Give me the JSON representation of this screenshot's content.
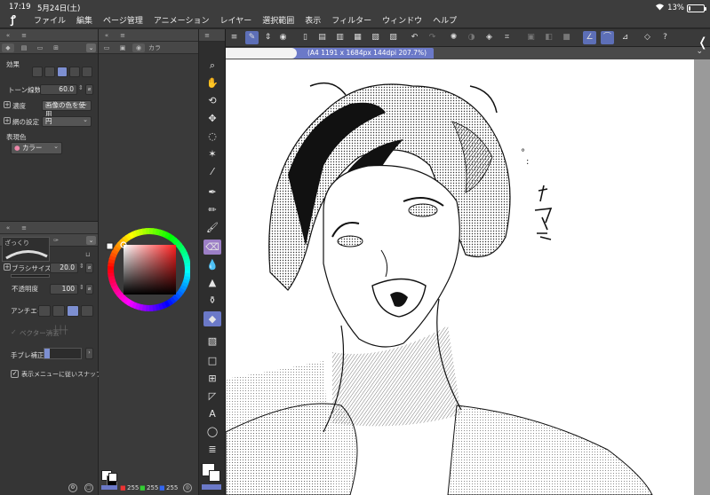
{
  "status": {
    "time": "17:19",
    "date": "5月24日(土)",
    "battery": "13%",
    "battery_level": 0.13
  },
  "menu": [
    "ファイル",
    "編集",
    "ページ管理",
    "アニメーション",
    "レイヤー",
    "選択範囲",
    "表示",
    "フィルター",
    "ウィンドウ",
    "ヘルプ"
  ],
  "left_tabs": {
    "palette_tab": "カラ"
  },
  "tool_props": {
    "effect_label": "効果",
    "tone_lines_label": "トーン線数",
    "tone_lines_value": "60.0",
    "density_label": "濃度",
    "density_value": "画像の色を使用",
    "screen_label": "網の設定",
    "screen_value": "円",
    "expression_color_label": "表現色",
    "expression_color_value": "カラー"
  },
  "brush_props": {
    "brush_name": "ざっくり",
    "size_label": "ブラシサイズ",
    "size_value": "20.0",
    "opacity_label": "不透明度",
    "opacity_value": "100",
    "antialias_label": "アンチエイリ",
    "vector_label": "ベクター消去",
    "stabilizer_label": "手ブレ補正",
    "snap_label": "表示メニューに従いスナップ"
  },
  "canvas": {
    "tab_info": "(A4 1191 x 1684px 144dpi 207.7%)"
  },
  "color_values": {
    "r": "255",
    "g": "255",
    "b": "255"
  },
  "icons": {
    "tools": [
      "zoom-icon",
      "hand-icon",
      "rotate-icon",
      "move-icon",
      "lasso-icon",
      "magic-wand-icon",
      "eyedropper-icon",
      "pen-icon",
      "pencil-icon",
      "brush-icon",
      "eraser-icon",
      "blend-icon",
      "fill-icon",
      "spray-icon",
      "paint-bucket-icon",
      "selected-tool-icon",
      "gradient-icon",
      "rectangle-icon",
      "frame-icon",
      "ruler-icon",
      "text-icon",
      "balloon-icon",
      "line-icon"
    ]
  },
  "colors": {
    "accent": "#6b79c8",
    "panel": "#353535",
    "menubar": "#3d3d3d"
  }
}
